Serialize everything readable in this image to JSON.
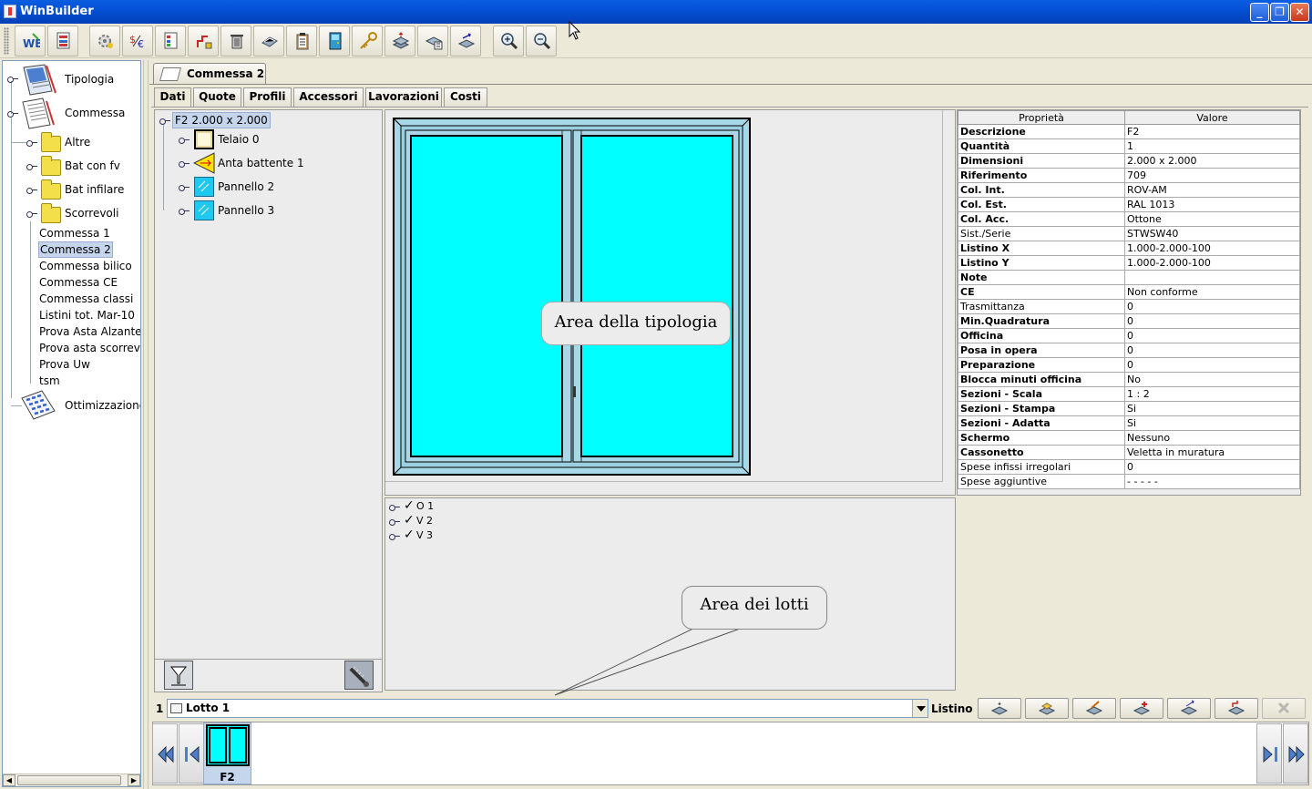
{
  "window": {
    "title": "WinBuilder",
    "controls": [
      "_",
      "❐",
      "✕"
    ]
  },
  "toolbar": {
    "buttons": [
      {
        "name": "wb-icon"
      },
      {
        "name": "report-icon"
      },
      {
        "name": "settings-icon"
      },
      {
        "name": "price-convert-icon"
      },
      {
        "name": "doc-list-icon"
      },
      {
        "name": "chart-icon"
      },
      {
        "name": "trash-icon"
      },
      {
        "name": "print-icon"
      },
      {
        "name": "clipboard-icon"
      },
      {
        "name": "door-icon"
      },
      {
        "name": "key-icon"
      },
      {
        "name": "stack-icon"
      },
      {
        "name": "calc-icon"
      },
      {
        "name": "transfer-icon"
      },
      {
        "name": "zoom-in-icon"
      },
      {
        "name": "zoom-out-icon"
      }
    ]
  },
  "sidebar": {
    "tipologia": "Tipologia",
    "commessa": "Commessa",
    "folders": [
      "Altre",
      "Bat con fv",
      "Bat infilare",
      "Scorrevoli"
    ],
    "items": [
      "Commessa 1",
      "Commessa 2",
      "Commessa bilico",
      "Commessa CE",
      "Commessa classi",
      "Listini tot. Mar-10",
      "Prova Asta Alzante",
      "Prova asta scorrevol",
      "Prova Uw",
      "tsm"
    ],
    "selected_item": "Commessa 2",
    "ottimizzazione": "Ottimizzazione"
  },
  "document": {
    "tab_label": "Commessa 2",
    "tabs": [
      "Dati",
      "Quote",
      "Profili",
      "Accessori",
      "Lavorazioni",
      "Costi"
    ],
    "active_tab": "Dati"
  },
  "structure_tree": {
    "root": "F2 2.000 x 2.000",
    "children": [
      "Telaio 0",
      "Anta battente 1",
      "Pannello 2",
      "Pannello 3"
    ]
  },
  "drawing": {
    "balloon": "Area della tipologia",
    "frame_color": "#a8d8e8",
    "glass_color": "#00ffff"
  },
  "lots": {
    "items": [
      "O 1",
      "V 2",
      "V 3"
    ],
    "balloon": "Area dei lotti"
  },
  "properties": {
    "headers": [
      "Proprietà",
      "Valore"
    ],
    "rows": [
      {
        "k": "Descrizione",
        "v": "F2",
        "bold": true
      },
      {
        "k": "Quantità",
        "v": "1",
        "bold": true
      },
      {
        "k": "Dimensioni",
        "v": "2.000 x 2.000",
        "bold": true
      },
      {
        "k": "Riferimento",
        "v": "709",
        "bold": true
      },
      {
        "k": "Col. Int.",
        "v": "ROV-AM",
        "bold": true
      },
      {
        "k": "Col. Est.",
        "v": "RAL 1013",
        "bold": true
      },
      {
        "k": "Col. Acc.",
        "v": "Ottone",
        "bold": true
      },
      {
        "k": "Sist./Serie",
        "v": "STWSW40",
        "bold": false
      },
      {
        "k": "Listino X",
        "v": "1.000-2.000-100",
        "bold": true
      },
      {
        "k": "Listino Y",
        "v": "1.000-2.000-100",
        "bold": true
      },
      {
        "k": "Note",
        "v": "",
        "bold": true
      },
      {
        "k": "CE",
        "v": "Non conforme",
        "bold": true
      },
      {
        "k": "Trasmittanza",
        "v": "0",
        "bold": false
      },
      {
        "k": "Min.Quadratura",
        "v": "0",
        "bold": true
      },
      {
        "k": "Officina",
        "v": "0",
        "bold": true
      },
      {
        "k": "Posa in opera",
        "v": "0",
        "bold": true
      },
      {
        "k": "Preparazione",
        "v": "0",
        "bold": true
      },
      {
        "k": "Blocca minuti officina",
        "v": "No",
        "bold": true
      },
      {
        "k": "Sezioni - Scala",
        "v": "1 : 2",
        "bold": true
      },
      {
        "k": "Sezioni - Stampa",
        "v": "Si",
        "bold": true
      },
      {
        "k": "Sezioni - Adatta",
        "v": "Si",
        "bold": true
      },
      {
        "k": "Schermo",
        "v": "Nessuno",
        "bold": true
      },
      {
        "k": "Cassonetto",
        "v": "Veletta in muratura",
        "bold": true
      },
      {
        "k": "Spese infissi irregolari",
        "v": "0",
        "bold": false
      },
      {
        "k": "Spese aggiuntive",
        "v": "- - - - -",
        "bold": false
      }
    ]
  },
  "lotbar": {
    "number": "1",
    "lot_label": "Lotto 1",
    "listino_label": "Listino 1"
  },
  "thumbnails": {
    "selected_label": "F2"
  }
}
